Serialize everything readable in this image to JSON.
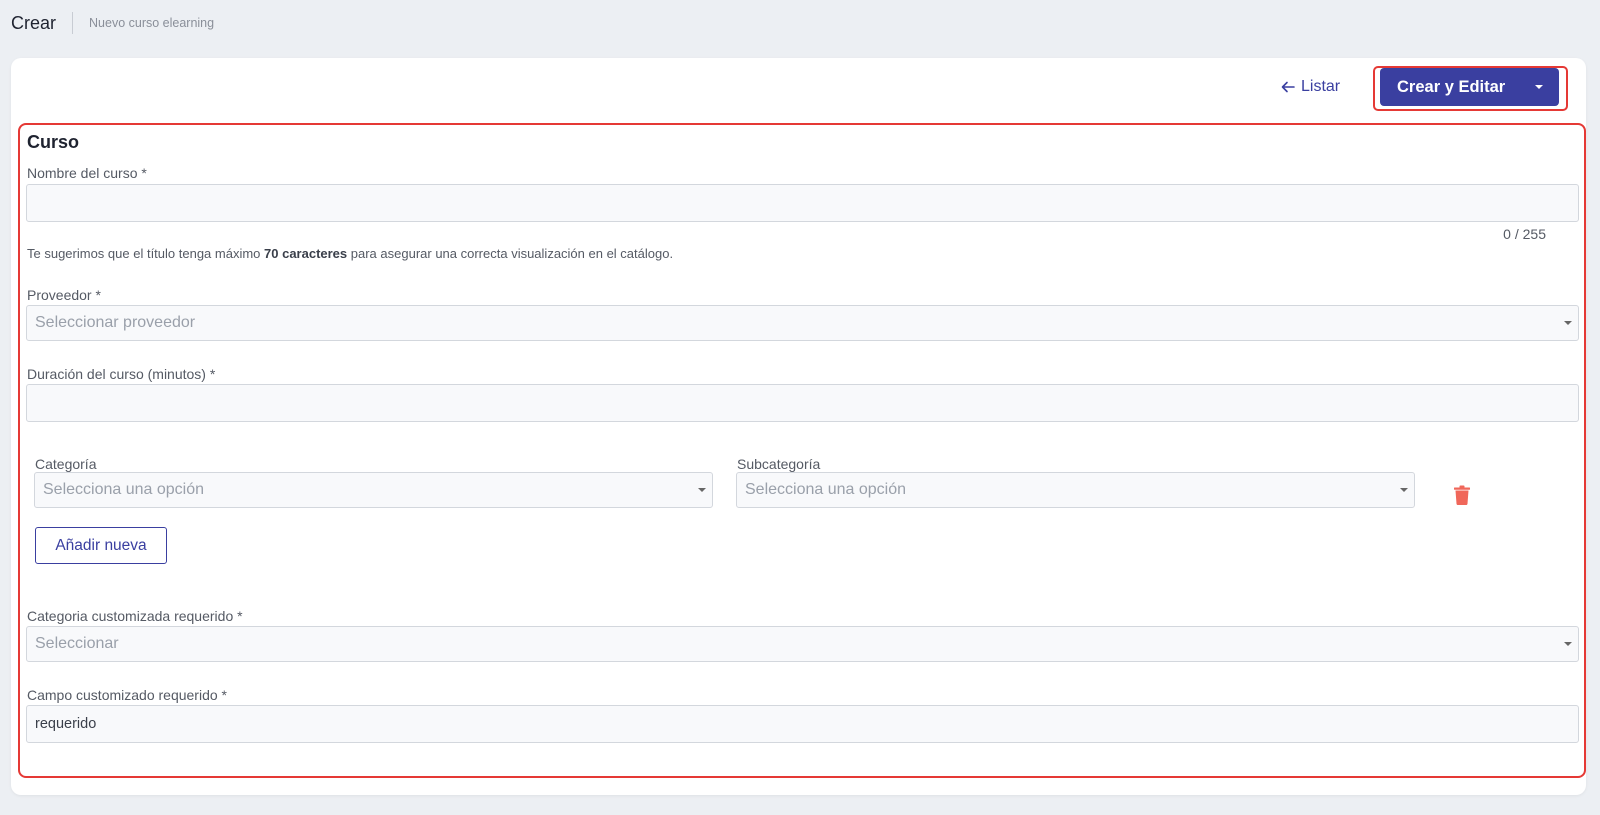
{
  "header": {
    "title": "Crear",
    "subtitle": "Nuevo curso elearning"
  },
  "toolbar": {
    "back_label": "Listar",
    "back_icon": "arrow-left-icon",
    "primary_label": "Crear y Editar",
    "primary_caret_icon": "caret-down-icon"
  },
  "form": {
    "section_title": "Curso",
    "course_name": {
      "label": "Nombre del curso *",
      "value": "",
      "counter": "0 / 255"
    },
    "hint": {
      "prefix": "Te sugerimos que el título tenga máximo ",
      "bold": "70 caracteres",
      "suffix": " para asegurar una correcta visualización en el catálogo."
    },
    "provider": {
      "label": "Proveedor *",
      "placeholder": "Seleccionar proveedor"
    },
    "duration": {
      "label": "Duración del curso (minutos) *",
      "value": ""
    },
    "category": {
      "label": "Categoría",
      "placeholder": "Selecciona una opción"
    },
    "subcategory": {
      "label": "Subcategoría",
      "placeholder": "Selecciona una opción"
    },
    "delete_icon": "trash-icon",
    "add_button": "Añadir nueva",
    "custom_category": {
      "label": "Categoria customizada requerido *",
      "placeholder": "Seleccionar"
    },
    "custom_field": {
      "label": "Campo customizado requerido *",
      "value": "requerido"
    }
  },
  "colors": {
    "primary": "#3a3fa0",
    "highlight": "#e53935",
    "danger": "#f0675a",
    "background": "#eceff3"
  }
}
